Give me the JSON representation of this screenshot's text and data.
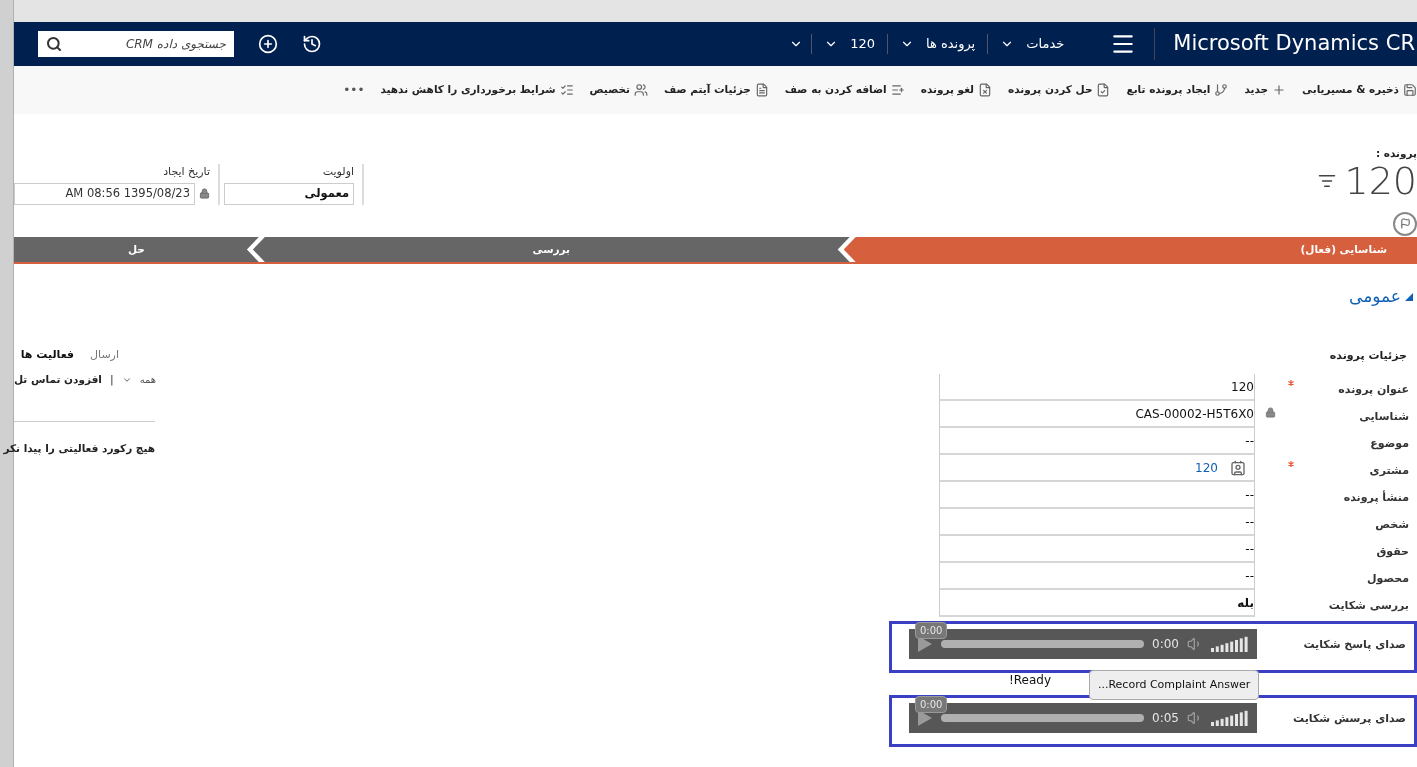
{
  "nav": {
    "search": {
      "placeholder": "جستجوی داده CRM"
    },
    "brand": "Microsoft Dynamics CR",
    "menus": [
      "خدمات",
      "پرونده ها",
      "120"
    ]
  },
  "toolbar": {
    "items": [
      "ذخیره & مسیریابی",
      "جدید",
      "ایجاد پرونده تابع",
      "حل کردن پرونده",
      "لغو پرونده",
      "اضافه کردن به صف",
      "جزئیات آیتم صف",
      "تخصیص",
      "شرایط برخورداری را کاهش ندهید"
    ],
    "more": "•••"
  },
  "record": {
    "entity_label": "پرونده :",
    "title": "120"
  },
  "header_fields": [
    {
      "label": "اولویت",
      "value": "معمولی",
      "locked": false
    },
    {
      "label": "تاریخ ایجاد",
      "value": "AM 08:56 1395/08/23",
      "locked": true
    }
  ],
  "stages": [
    {
      "label": "شناسایی (فعال)",
      "selected": true
    },
    {
      "label": "بررسی",
      "selected": false
    },
    {
      "label": "حل",
      "selected": false
    }
  ],
  "section": {
    "title": "عمومی",
    "expanded": true
  },
  "activities": {
    "tabs": [
      {
        "label": "ارسال",
        "selected": false
      },
      {
        "label": "فعالیت ها",
        "selected": true
      }
    ],
    "filter": "همه",
    "separator": "|",
    "add_link": "افزودن تماس تل",
    "empty": "هیچ رکورد فعالیتی را پیدا نکر"
  },
  "details": {
    "title": "جزئیات پرونده",
    "fields": [
      {
        "label": "عنوان پرونده",
        "value": "120",
        "required": true,
        "locked": false,
        "kind": "text"
      },
      {
        "label": "شناسایی",
        "value": "CAS-00002-H5T6X0",
        "required": false,
        "locked": true,
        "kind": "text"
      },
      {
        "label": "موضوع",
        "value": "--",
        "required": false,
        "locked": false,
        "kind": "text"
      },
      {
        "label": "مشتری",
        "value": "120",
        "required": true,
        "locked": false,
        "kind": "link"
      },
      {
        "label": "منشأ پرونده",
        "value": "--",
        "required": false,
        "locked": false,
        "kind": "text"
      },
      {
        "label": "شخص",
        "value": "--",
        "required": false,
        "locked": false,
        "kind": "text"
      },
      {
        "label": "حقوق",
        "value": "--",
        "required": false,
        "locked": false,
        "kind": "text"
      },
      {
        "label": "محصول",
        "value": "--",
        "required": false,
        "locked": false,
        "kind": "text"
      },
      {
        "label": "بررسی شکایت",
        "value": "بله",
        "required": false,
        "locked": false,
        "kind": "bold"
      }
    ]
  },
  "audio": [
    {
      "label": "صدای پاسخ شکایت",
      "tooltip": "0:00",
      "time": "0:00"
    },
    {
      "label": "صدای پرسش شکایت",
      "tooltip": "0:00",
      "time": "0:05"
    }
  ],
  "recorder": {
    "button": "Record Complaint Answer...",
    "status": "Ready!"
  }
}
